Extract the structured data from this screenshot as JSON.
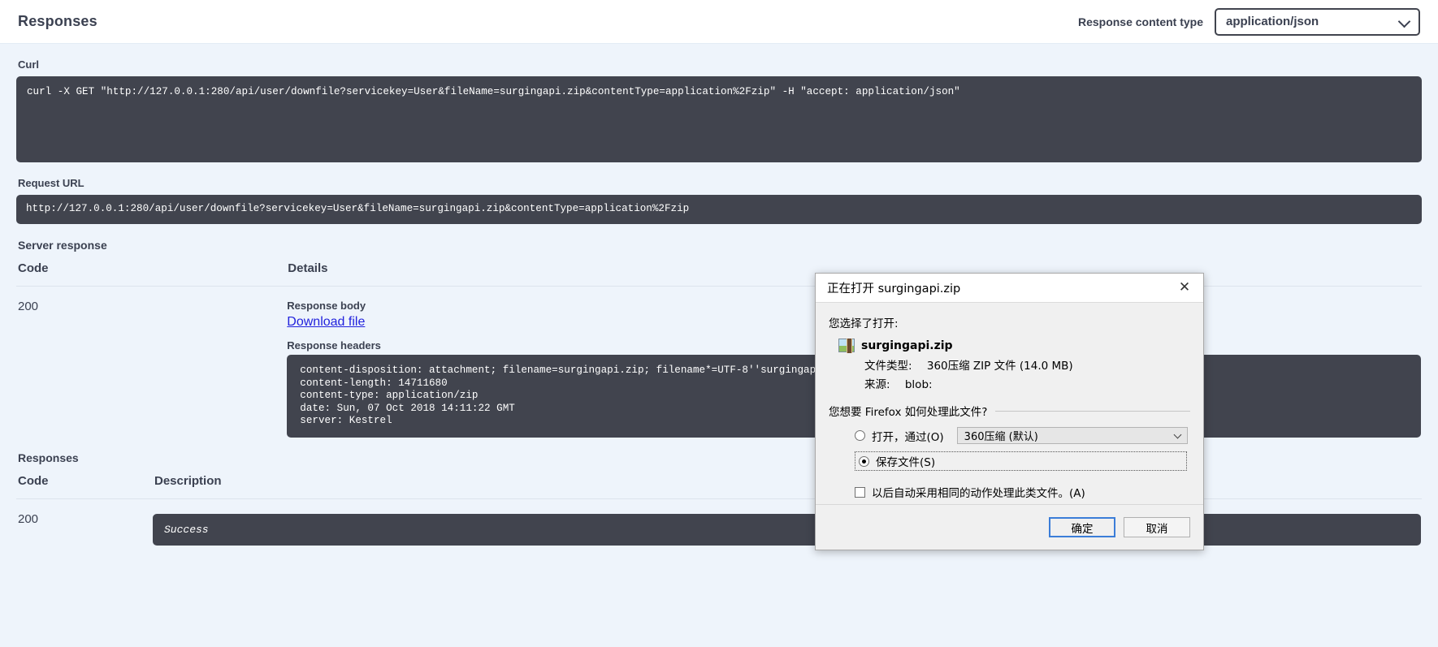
{
  "top_bar": {
    "title": "Responses",
    "content_type_label": "Response content type",
    "content_type_value": "application/json",
    "chevron_icon": "chevron-down-icon"
  },
  "curl": {
    "label": "Curl",
    "command": "curl -X GET \"http://127.0.0.1:280/api/user/downfile?servicekey=User&fileName=surgingapi.zip&contentType=application%2Fzip\" -H \"accept: application/json\""
  },
  "request_url": {
    "label": "Request URL",
    "url": "http://127.0.0.1:280/api/user/downfile?servicekey=User&fileName=surgingapi.zip&contentType=application%2Fzip"
  },
  "server_response": {
    "title": "Server response",
    "columns": {
      "code": "Code",
      "details": "Details"
    },
    "row": {
      "code": "200",
      "response_body_label": "Response body",
      "download_link": "Download file",
      "response_headers_label": "Response headers",
      "headers": "content-disposition: attachment; filename=surgingapi.zip; filename*=UTF-8''surgingapi.zip\ncontent-length: 14711680\ncontent-type: application/zip\ndate: Sun, 07 Oct 2018 14:11:22 GMT\nserver: Kestrel"
    }
  },
  "responses_table": {
    "title": "Responses",
    "columns": {
      "code": "Code",
      "description": "Description"
    },
    "row": {
      "code": "200",
      "description": "Success"
    }
  },
  "dialog": {
    "title": "正在打开 surgingapi.zip",
    "close_icon": "close-icon",
    "intro": "您选择了打开:",
    "file_icon": "zip-file-icon",
    "file_name": "surgingapi.zip",
    "file_type_key": "文件类型:",
    "file_type_value": "360压缩 ZIP 文件 (14.0 MB)",
    "source_key": "来源:",
    "source_value": "blob:",
    "question": "您想要 Firefox 如何处理此文件?",
    "open_with_label": "打开，通过(O)",
    "open_with_app": "360压缩 (默认)",
    "open_with_chevron": "chevron-down-icon",
    "save_file_label": "保存文件(S)",
    "remember_label": "以后自动采用相同的动作处理此类文件。(A)",
    "ok_button": "确定",
    "cancel_button": "取消"
  }
}
